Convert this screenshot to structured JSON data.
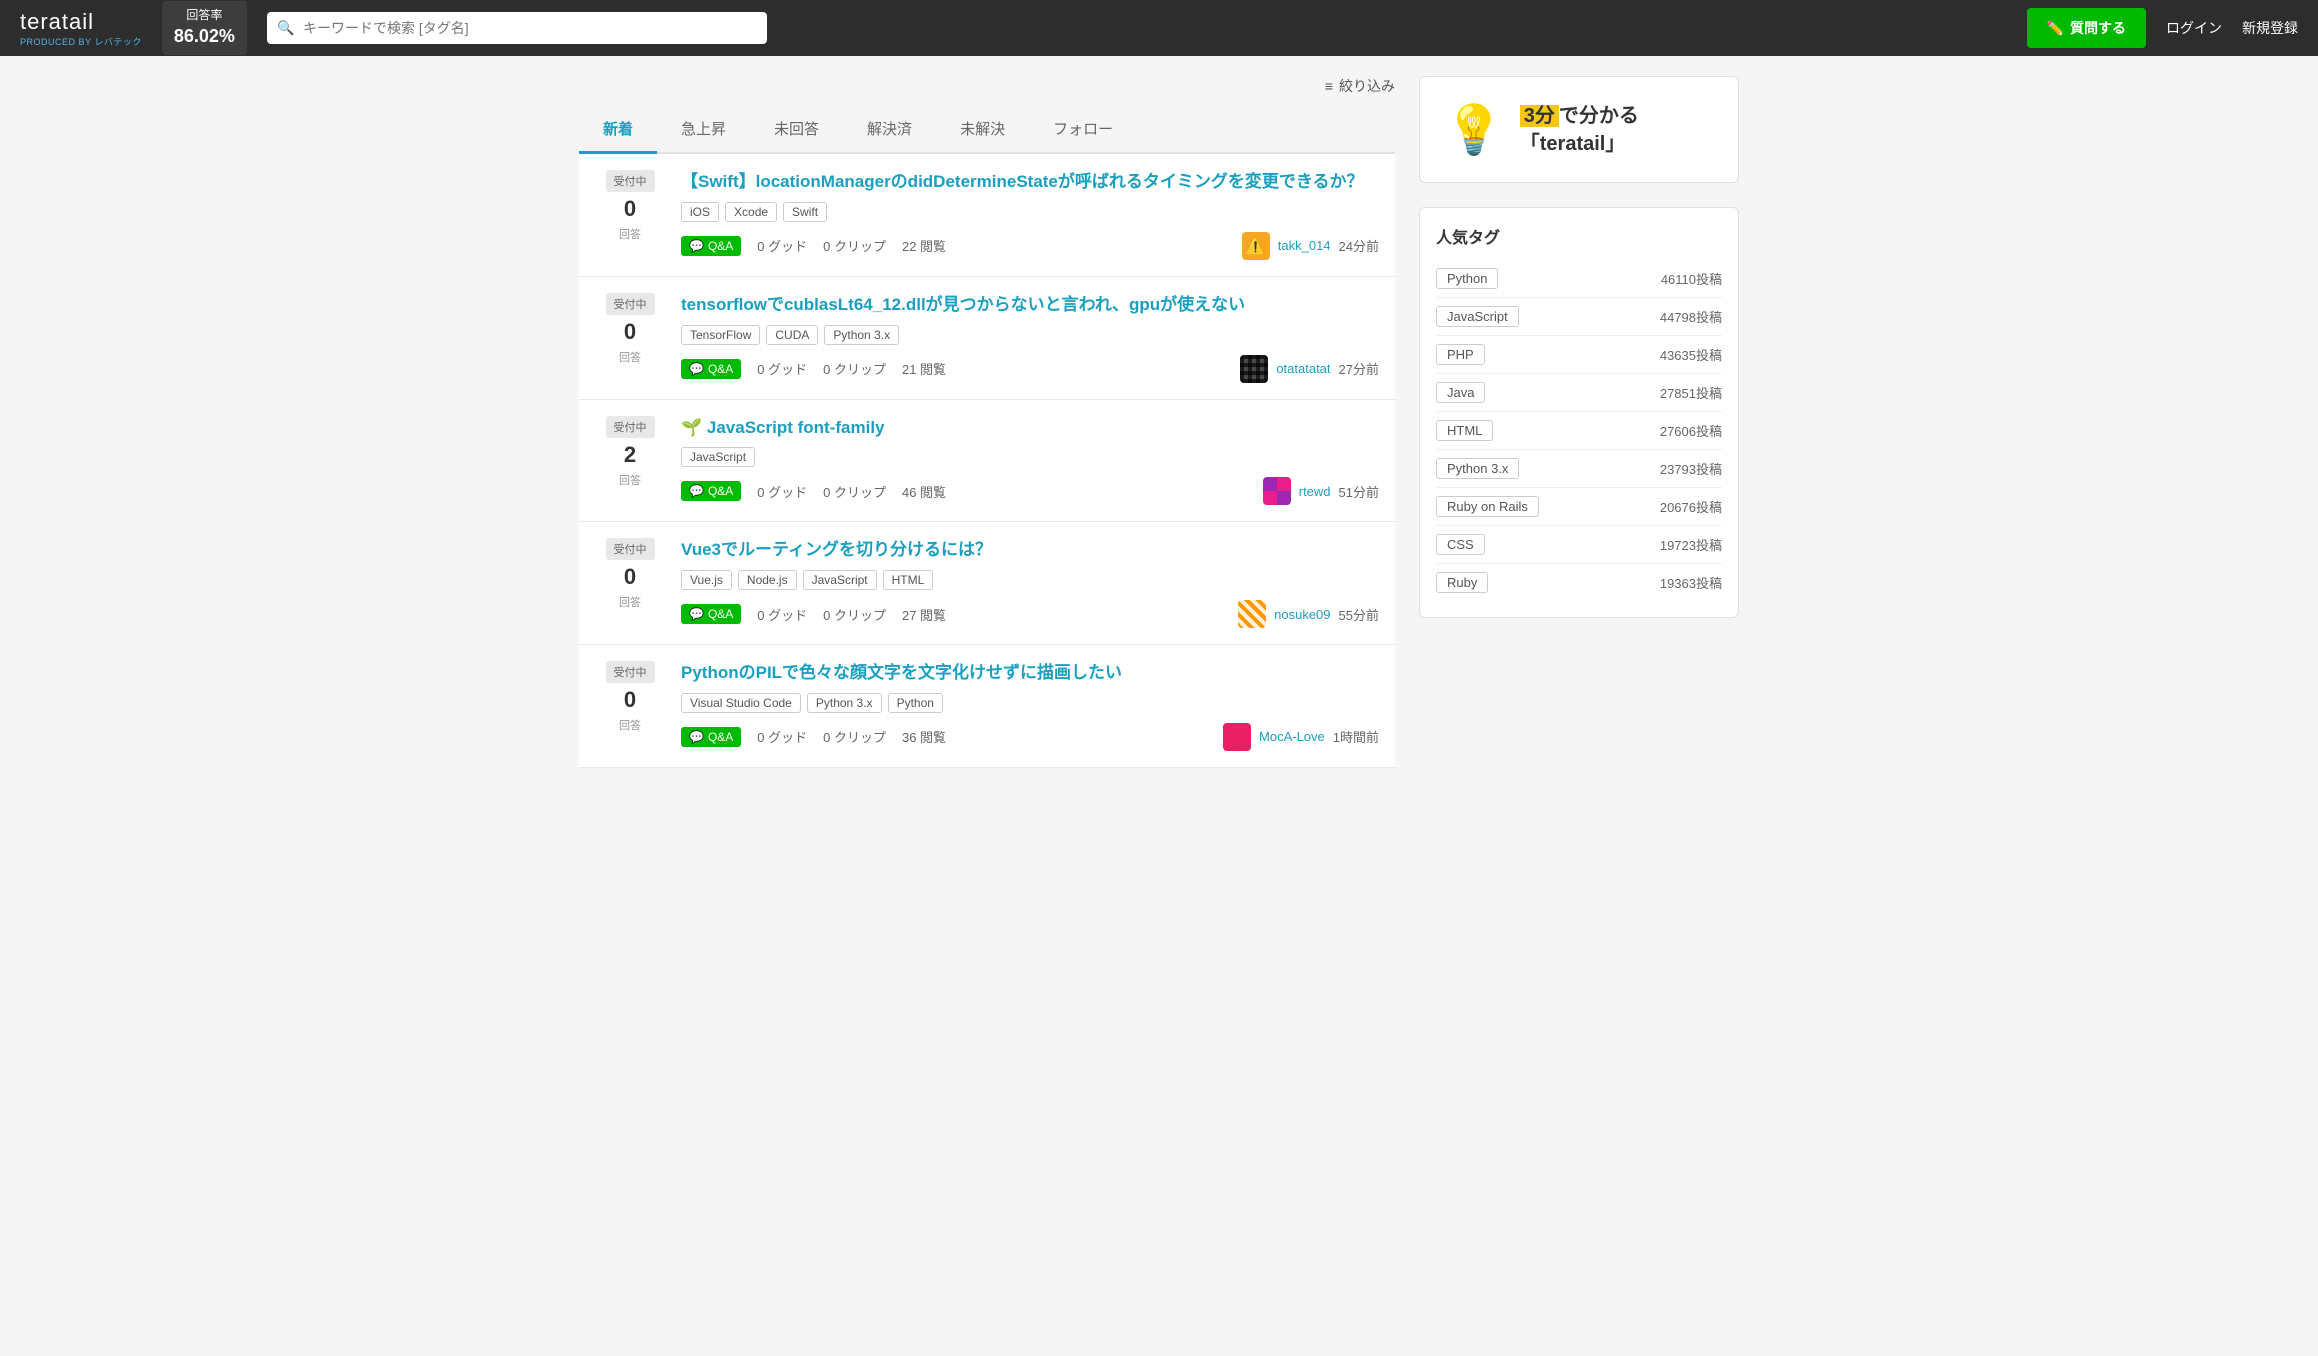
{
  "header": {
    "logo": "teratail",
    "produced_by": "PRODUCED BY",
    "company": "レバテック",
    "stat_label": "回答率",
    "stat_value": "86.02%",
    "search_placeholder": "キーワードで検索 [タグ名]",
    "ask_button": "質問する",
    "login": "ログイン",
    "register": "新規登録"
  },
  "filter": {
    "label": "絞り込み"
  },
  "tabs": [
    {
      "label": "新着",
      "active": true
    },
    {
      "label": "急上昇",
      "active": false
    },
    {
      "label": "未回答",
      "active": false
    },
    {
      "label": "解決済",
      "active": false
    },
    {
      "label": "未解決",
      "active": false
    },
    {
      "label": "フォロー",
      "active": false
    }
  ],
  "questions": [
    {
      "status": "受付中",
      "answer_count": "0",
      "answer_label": "回答",
      "title": "【Swift】locationManagerのdidDetermineStateが呼ばれるタイミングを変更できるか？",
      "tags": [
        "iOS",
        "Xcode",
        "Swift"
      ],
      "type": "Q&A",
      "good": "0 グッド",
      "clip": "0 クリップ",
      "views": "22 閲覧",
      "user": "takk_014",
      "time": "24分前",
      "avatar_type": "warning"
    },
    {
      "status": "受付中",
      "answer_count": "0",
      "answer_label": "回答",
      "title": "tensorflowでcublasLt64_12.dllが見つからないと言われ、gpuが使えない",
      "tags": [
        "TensorFlow",
        "CUDA",
        "Python 3.x"
      ],
      "type": "Q&A",
      "good": "0 グッド",
      "clip": "0 クリップ",
      "views": "21 閲覧",
      "user": "otatatatat",
      "time": "27分前",
      "avatar_type": "grid"
    },
    {
      "status": "受付中",
      "answer_count": "2",
      "answer_label": "回答",
      "title": "🌱 JavaScript font-family",
      "tags": [
        "JavaScript"
      ],
      "type": "Q&A",
      "good": "0 グッド",
      "clip": "0 クリップ",
      "views": "46 閲覧",
      "user": "rtewd",
      "time": "51分前",
      "avatar_type": "mosaic"
    },
    {
      "status": "受付中",
      "answer_count": "0",
      "answer_label": "回答",
      "title": "Vue3でルーティングを切り分けるには？",
      "tags": [
        "Vue.js",
        "Node.js",
        "JavaScript",
        "HTML"
      ],
      "type": "Q&A",
      "good": "0 グッド",
      "clip": "0 クリップ",
      "views": "27 閲覧",
      "user": "nosuke09",
      "time": "55分前",
      "avatar_type": "pixel"
    },
    {
      "status": "受付中",
      "answer_count": "0",
      "answer_label": "回答",
      "title": "PythonのPILで色々な顔文字を文字化けせずに描画したい",
      "tags": [
        "Visual Studio Code",
        "Python 3.x",
        "Python"
      ],
      "type": "Q&A",
      "good": "0 グッド",
      "clip": "0 クリップ",
      "views": "36 閲覧",
      "user": "MocA-Love",
      "time": "1時間前",
      "avatar_type": "pink"
    }
  ],
  "promo": {
    "icon": "💡",
    "text_line1": "3分で分かる",
    "highlight": "3分",
    "text_line2": "「teratail」"
  },
  "popular_tags": {
    "title": "人気タグ",
    "tags": [
      {
        "name": "Python",
        "count": "46110投稿"
      },
      {
        "name": "JavaScript",
        "count": "44798投稿"
      },
      {
        "name": "PHP",
        "count": "43635投稿"
      },
      {
        "name": "Java",
        "count": "27851投稿"
      },
      {
        "name": "HTML",
        "count": "27606投稿"
      },
      {
        "name": "Python 3.x",
        "count": "23793投稿"
      },
      {
        "name": "Ruby on Rails",
        "count": "20676投稿"
      },
      {
        "name": "CSS",
        "count": "19723投稿"
      },
      {
        "name": "Ruby",
        "count": "19363投稿"
      }
    ]
  }
}
